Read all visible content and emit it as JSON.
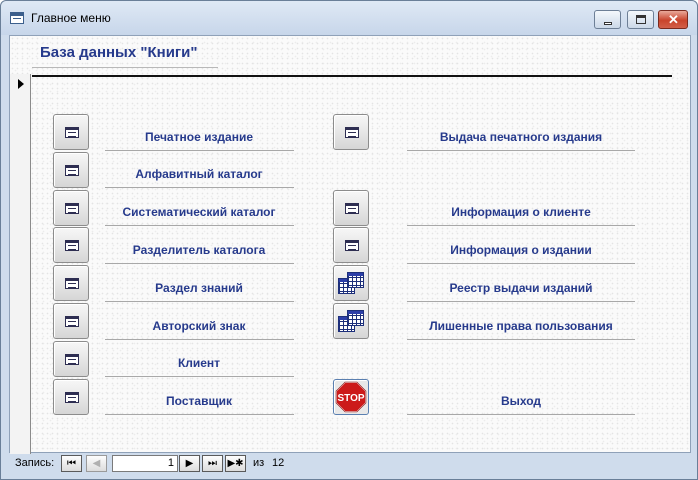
{
  "window": {
    "title": "Главное меню",
    "controls": {
      "minimize": "minimize-icon",
      "maximize": "maximize-icon",
      "close": "close-icon"
    }
  },
  "form": {
    "header_title": "База данных \"Книги\""
  },
  "menu_left": [
    {
      "label": "Печатное издание",
      "icon": "form-icon"
    },
    {
      "label": "Алфавитный каталог",
      "icon": "form-icon"
    },
    {
      "label": "Систематический каталог",
      "icon": "form-icon"
    },
    {
      "label": "Разделитель каталога",
      "icon": "form-icon"
    },
    {
      "label": "Раздел знаний",
      "icon": "form-icon"
    },
    {
      "label": "Авторский знак",
      "icon": "form-icon"
    },
    {
      "label": "Клиент",
      "icon": "form-icon"
    },
    {
      "label": "Поставщик",
      "icon": "form-icon"
    }
  ],
  "menu_right": [
    {
      "label": "Выдача печатного издания",
      "icon": "form-icon"
    },
    {
      "label": "Информация о клиенте",
      "icon": "form-icon"
    },
    {
      "label": "Информация о издании",
      "icon": "form-icon"
    },
    {
      "label": "Реестр выдачи изданий",
      "icon": "table-icon"
    },
    {
      "label": "Лишенные права пользования",
      "icon": "table-icon"
    },
    {
      "label": "Выход",
      "icon": "stop-icon",
      "icon_text": "STOP"
    }
  ],
  "navigation": {
    "record_label": "Запись:",
    "current": "1",
    "of_label": "из",
    "total": "12",
    "buttons": {
      "first": "⏮",
      "prev": "◀",
      "next": "▶",
      "last": "⏭",
      "new": "▶✱"
    }
  },
  "colors": {
    "label_text": "#263a8c",
    "stop_red": "#cc1a1a"
  }
}
